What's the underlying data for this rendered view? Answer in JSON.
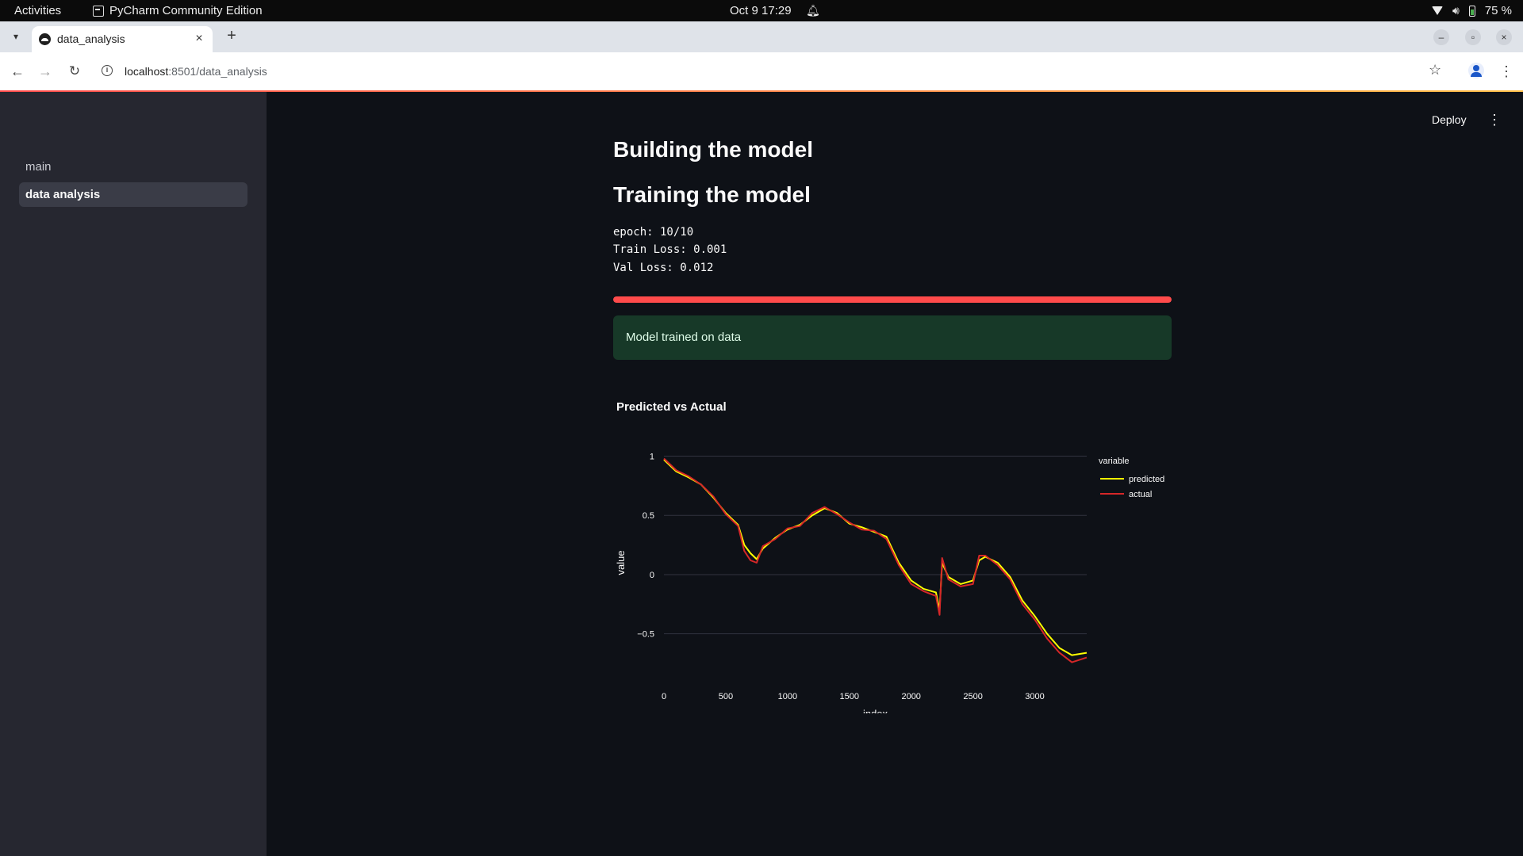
{
  "os": {
    "activities": "Activities",
    "app": "PyCharm Community Edition",
    "clock": "Oct 9  17:29",
    "battery": "75 %"
  },
  "browser": {
    "tab_title": "data_analysis",
    "url_host": "localhost",
    "url_rest": ":8501/data_analysis"
  },
  "sidebar": {
    "items": [
      {
        "label": "main",
        "active": false
      },
      {
        "label": "data analysis",
        "active": true
      }
    ]
  },
  "app": {
    "deploy_label": "Deploy",
    "heading_build": "Building the model",
    "heading_train": "Training the model",
    "log": {
      "epoch": "epoch: 10/10",
      "train_loss": "Train Loss: 0.001",
      "val_loss": "Val Loss: 0.012"
    },
    "progress": 1.0,
    "success_message": "Model trained on data",
    "chart_title": "Predicted vs Actual"
  },
  "colors": {
    "accent": "#ff4b4b",
    "predicted": "#ffff00",
    "actual": "#d62728",
    "success_bg": "#173928"
  },
  "chart_data": {
    "type": "line",
    "title": "Predicted vs Actual",
    "xlabel": "index",
    "ylabel": "value",
    "xlim": [
      0,
      3420
    ],
    "ylim": [
      -0.85,
      1.05
    ],
    "xticks": [
      "0",
      "500",
      "1000",
      "1500",
      "2000",
      "2500",
      "3000"
    ],
    "yticks": [
      "1",
      "0.5",
      "0",
      "−0.5"
    ],
    "legend_title": "variable",
    "legend_position": "top-right",
    "grid": true,
    "x": [
      0,
      100,
      200,
      300,
      400,
      500,
      600,
      650,
      700,
      750,
      800,
      900,
      1000,
      1100,
      1200,
      1300,
      1400,
      1500,
      1600,
      1700,
      1800,
      1900,
      2000,
      2100,
      2200,
      2230,
      2250,
      2300,
      2400,
      2500,
      2550,
      2600,
      2700,
      2800,
      2900,
      3000,
      3100,
      3200,
      3300,
      3420
    ],
    "series": [
      {
        "name": "predicted",
        "values": [
          0.97,
          0.87,
          0.82,
          0.76,
          0.65,
          0.52,
          0.42,
          0.25,
          0.18,
          0.13,
          0.22,
          0.31,
          0.38,
          0.42,
          0.5,
          0.56,
          0.52,
          0.43,
          0.4,
          0.36,
          0.32,
          0.1,
          -0.05,
          -0.12,
          -0.15,
          -0.3,
          0.1,
          -0.02,
          -0.08,
          -0.05,
          0.12,
          0.15,
          0.1,
          -0.02,
          -0.22,
          -0.35,
          -0.5,
          -0.62,
          -0.68,
          -0.66
        ]
      },
      {
        "name": "actual",
        "values": [
          0.98,
          0.88,
          0.83,
          0.76,
          0.66,
          0.51,
          0.41,
          0.2,
          0.12,
          0.1,
          0.24,
          0.3,
          0.39,
          0.41,
          0.52,
          0.57,
          0.51,
          0.44,
          0.38,
          0.37,
          0.3,
          0.08,
          -0.08,
          -0.14,
          -0.18,
          -0.34,
          0.14,
          -0.04,
          -0.1,
          -0.08,
          0.16,
          0.16,
          0.08,
          -0.04,
          -0.25,
          -0.38,
          -0.54,
          -0.66,
          -0.74,
          -0.7
        ]
      }
    ]
  }
}
